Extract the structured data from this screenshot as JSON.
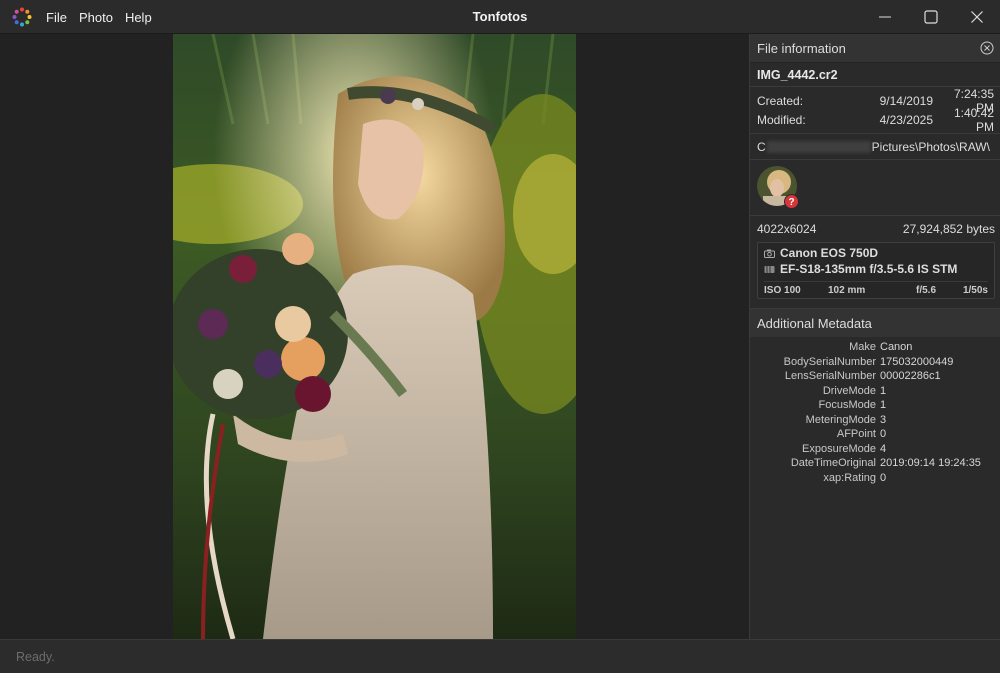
{
  "window": {
    "title": "Tonfotos",
    "menu": [
      "File",
      "Photo",
      "Help"
    ]
  },
  "icons": {
    "logo": "tonfotos-logo-icon",
    "minimize": "minimize-icon",
    "maximize": "maximize-icon",
    "close": "close-icon",
    "panel_close": "close-circle-icon",
    "camera": "camera-icon",
    "lens": "lens-icon",
    "question": "question-badge-icon"
  },
  "info_panel": {
    "header": "File information",
    "file_name": "IMG_4442.cr2",
    "created_label": "Created:",
    "created_date": "9/14/2019",
    "created_time": "7:24:35 PM",
    "modified_label": "Modified:",
    "modified_date": "4/23/2025",
    "modified_time": "1:40:42 PM",
    "path_prefix": "C",
    "path_suffix": "Pictures\\Photos\\RAW\\",
    "face_badge": "?",
    "dimensions": "4022x6024",
    "file_size": "27,924,852 bytes",
    "camera": "Canon EOS 750D",
    "lens": "EF-S18-135mm f/3.5-5.6 IS STM",
    "iso": "ISO 100",
    "focal_length": "102 mm",
    "aperture": "f/5.6",
    "shutter": "1/50s"
  },
  "metadata": {
    "header": "Additional Metadata",
    "rows": [
      {
        "key": "Make",
        "value": "Canon"
      },
      {
        "key": "BodySerialNumber",
        "value": "175032000449"
      },
      {
        "key": "LensSerialNumber",
        "value": "00002286c1"
      },
      {
        "key": "DriveMode",
        "value": "1"
      },
      {
        "key": "FocusMode",
        "value": "1"
      },
      {
        "key": "MeteringMode",
        "value": "3"
      },
      {
        "key": "AFPoint",
        "value": "0"
      },
      {
        "key": "ExposureMode",
        "value": "4"
      },
      {
        "key": "DateTimeOriginal",
        "value": "2019:09:14 19:24:35"
      },
      {
        "key": "xap:Rating",
        "value": "0"
      }
    ]
  },
  "status": {
    "text": "Ready."
  }
}
